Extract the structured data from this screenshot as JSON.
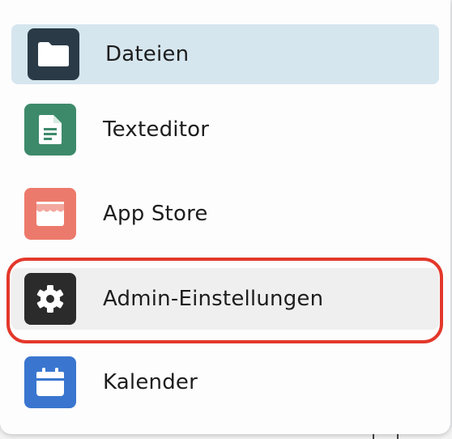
{
  "menu": {
    "items": [
      {
        "label": "Dateien",
        "icon": "folder-icon",
        "color": "#2a3b47",
        "selected": true
      },
      {
        "label": "Texteditor",
        "icon": "document-icon",
        "color": "#3d8a6b"
      },
      {
        "label": "App Store",
        "icon": "store-icon",
        "color": "#ec7a6c"
      },
      {
        "label": "Admin-Einstellungen",
        "icon": "gear-icon",
        "color": "#2b2b2b",
        "highlighted": true
      },
      {
        "label": "Kalender",
        "icon": "calendar-icon",
        "color": "#3a76cf"
      }
    ],
    "highlight_color": "#e3382b"
  }
}
